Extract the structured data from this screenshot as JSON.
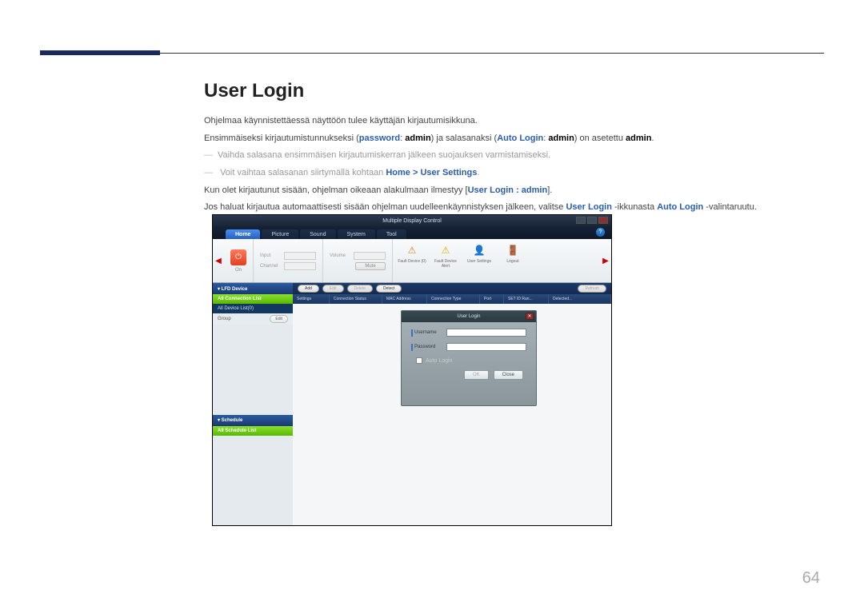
{
  "page_number": "64",
  "heading": "User Login",
  "paragraphs": {
    "p1": "Ohjelmaa käynnistettäessä näyttöön tulee käyttäjän kirjautumisikkuna.",
    "p2_parts": {
      "t1": "Ensimmäiseksi kirjautumistunnukseksi (",
      "password": "password",
      "t2": ": ",
      "admin1": "admin",
      "t3": ") ja salasanaksi (",
      "autologin": "Auto Login",
      "t4": ": ",
      "admin2": "admin",
      "t5": ") on asetettu ",
      "admin3": "admin",
      "t6": "."
    },
    "note1": "Vaihda salasana ensimmäisen kirjautumiskerran jälkeen suojauksen varmistamiseksi.",
    "note2_parts": {
      "t1": "Voit vaihtaa salasanan siirtymällä kohtaan ",
      "link": "Home > User Settings",
      "t2": "."
    },
    "p3_parts": {
      "t1": "Kun olet kirjautunut sisään, ohjelman oikeaan alakulmaan ilmestyy [",
      "link": "User Login : admin",
      "t2": "]."
    },
    "p4_parts": {
      "t1": "Jos haluat kirjautua automaattisesti sisään ohjelman uudelleenkäynnistyksen jälkeen, valitse ",
      "userlogin": "User Login",
      "t2": " -ikkunasta ",
      "autologin": "Auto Login",
      "t3": " -valintaruutu."
    }
  },
  "app": {
    "title": "Multiple Display Control",
    "help": "?",
    "tabs": [
      "Home",
      "Picture",
      "Sound",
      "System",
      "Tool"
    ],
    "toolbar": {
      "power_label": "On",
      "input_label": "Input",
      "channel_label": "Channel",
      "volume_label": "Volume",
      "mute": "Mute",
      "icons": [
        {
          "name": "fault-device-icon",
          "glyph": "⚠",
          "label": "Fault Device (0)",
          "color": "#e08020"
        },
        {
          "name": "fault-alert-icon",
          "glyph": "⚠",
          "label": "Fault Device Alert",
          "color": "#e0b000"
        },
        {
          "name": "user-settings-icon",
          "glyph": "👤",
          "label": "User Settings",
          "color": "#3a80d0"
        },
        {
          "name": "logout-icon",
          "glyph": "🚪",
          "label": "Logout",
          "color": "#a05020"
        }
      ]
    },
    "sidebar": {
      "lfd_header": "▾ LFD Device",
      "all_connection": "All Connection List",
      "all_device": "All Device List(0)",
      "group_label": "Group",
      "edit_btn": "Edit",
      "schedule_header": "▾ Schedule",
      "all_schedule": "All Schedule List"
    },
    "grid": {
      "toolbar_btns": [
        "Add",
        "Edit",
        "Delete",
        "Detect"
      ],
      "refresh_btn": "Refresh",
      "columns": [
        "Settings",
        "Connection Status",
        "MAC Address",
        "Connection Type",
        "Port",
        "SET ID Ran...",
        "Detected..."
      ]
    },
    "login": {
      "title": "User Login",
      "username_label": "Username",
      "password_label": "Password",
      "auto_login_label": "Auto Login",
      "ok_btn": "OK",
      "close_btn": "Close"
    }
  }
}
